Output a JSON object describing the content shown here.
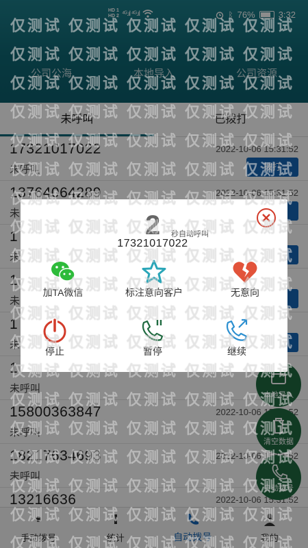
{
  "status_bar": {
    "hd_top": "HD 1",
    "hd_bottom": "HD 2",
    "signal": "⁴ᴳ.ıl ⁴ᴳ.ıl",
    "battery_percent": "76%",
    "time": "3:32"
  },
  "top_tabs": [
    "公司公海",
    "本地导入",
    "公司资源"
  ],
  "sub_tabs": {
    "uncalled": "未呼叫",
    "called": "已拨打"
  },
  "list": [
    {
      "phone": "17321017022",
      "status": "未呼叫",
      "time": "2022-10-06 15:31:52",
      "button": "拨打"
    },
    {
      "phone": "13764064289",
      "status": "未呼叫",
      "time": "2022-10-06 15:31:52",
      "button": ""
    },
    {
      "phone": "1",
      "status": "未呼叫",
      "time": "",
      "button": ""
    },
    {
      "phone": "1",
      "status": "未呼叫",
      "time": "",
      "button": ""
    },
    {
      "phone": "1",
      "status": "未呼叫",
      "time": "",
      "button": ""
    },
    {
      "phone": "1",
      "status": "未呼叫",
      "time": "",
      "button": ""
    },
    {
      "phone": "15800363847",
      "status": "未呼叫",
      "time": "2022-10-06 15:31:52",
      "button": ""
    },
    {
      "phone": "18217634693",
      "status": "未呼叫",
      "time": "2022-10-06 15:31:52",
      "button": ""
    },
    {
      "phone": "13216636",
      "status": "未呼叫",
      "time": "2022-10-06 15:31:52",
      "button": ""
    }
  ],
  "fabs": {
    "import": "本地导入",
    "clear": "清空数据",
    "auto": "自动拨号"
  },
  "bottom_nav": [
    "手动拨号",
    "统计",
    "自动拨号",
    "我的"
  ],
  "dialog": {
    "countdown": "2",
    "countdown_label": "秒自动呼叫",
    "number": "17321017022",
    "actions": [
      "加TA微信",
      "标注意向客户",
      "无意向",
      "停止",
      "暂停",
      "继续"
    ]
  },
  "watermark_text": "仅测试",
  "colors": {
    "header": "#0e6774",
    "primary_blue": "#1566b8",
    "fab_green": "#1f6a40",
    "stop_red": "#d23b2a",
    "star_teal": "#2aa6b8"
  }
}
